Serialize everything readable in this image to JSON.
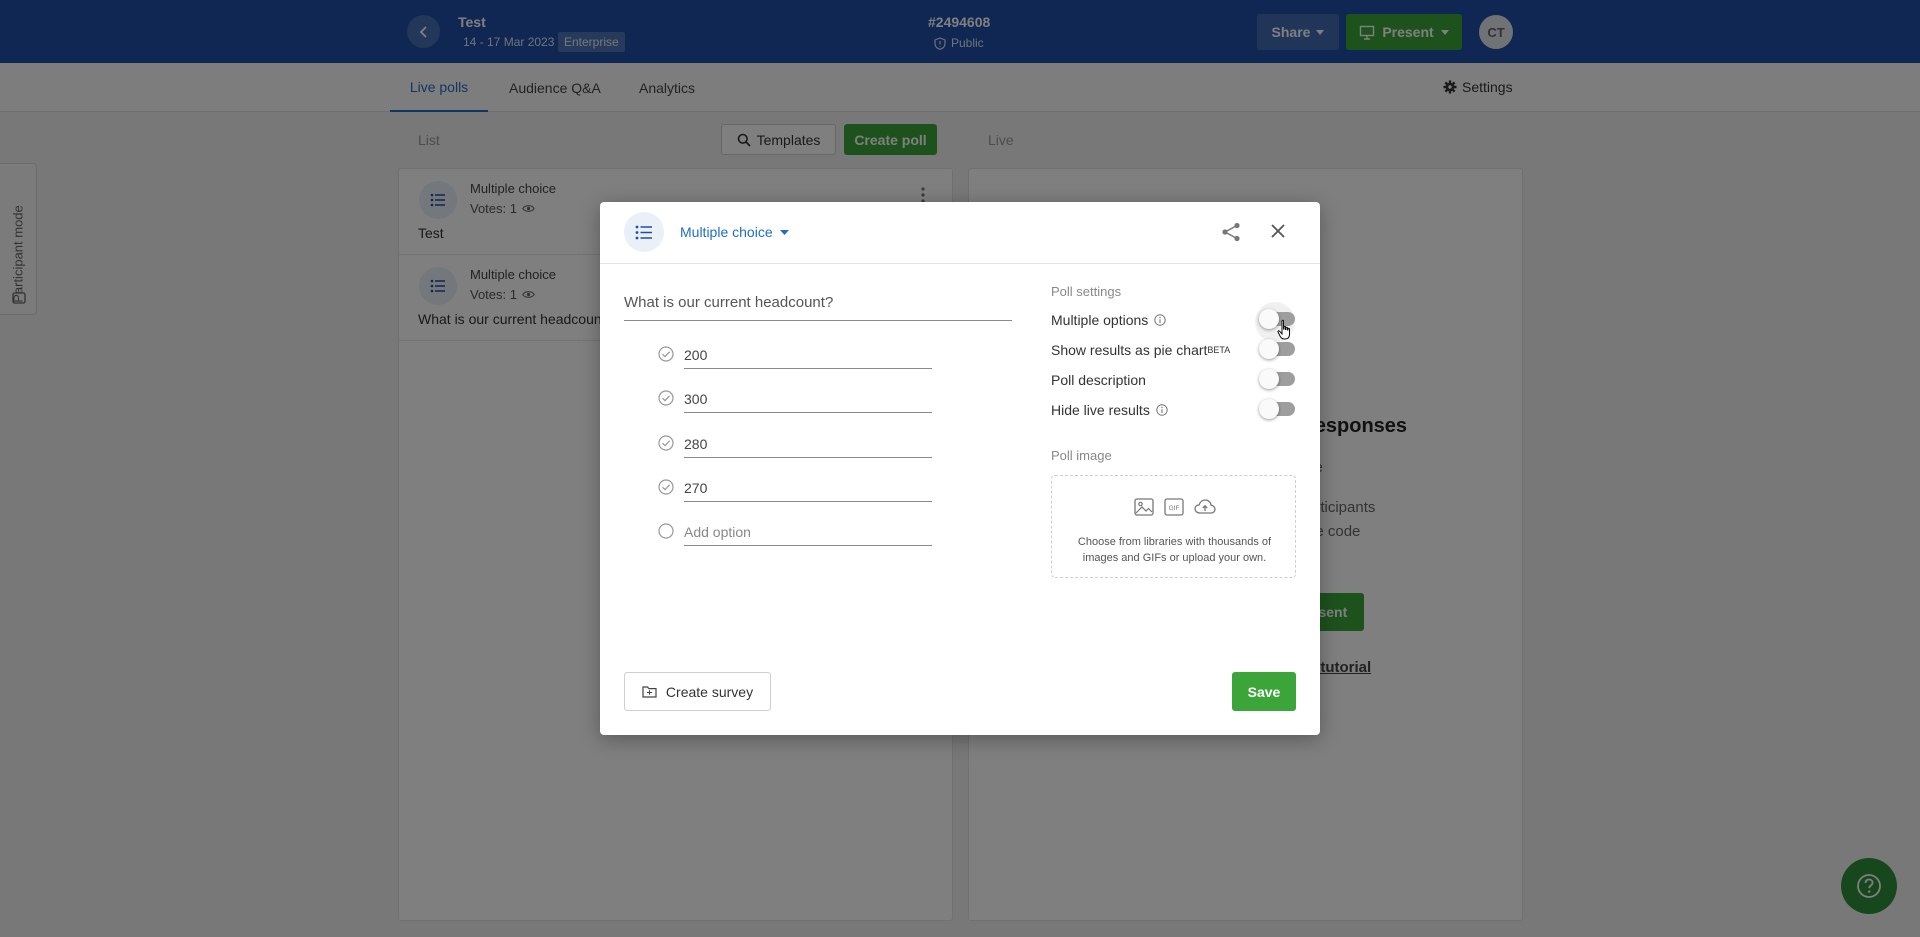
{
  "header": {
    "event_title": "Test",
    "event_dates": "14 - 17 Mar 2023",
    "plan_badge": "Enterprise",
    "event_code": "#2494608",
    "privacy": "Public",
    "share_label": "Share",
    "present_label": "Present",
    "avatar_initials": "CT",
    "accent_color": "#1e4fa4"
  },
  "tabs": {
    "live_polls": "Live polls",
    "audience_qa": "Audience Q&A",
    "analytics": "Analytics",
    "settings": "Settings"
  },
  "side_tab": {
    "label": "Participant mode"
  },
  "list_column": {
    "label": "List",
    "templates_label": "Templates",
    "create_poll_label": "Create poll",
    "polls": [
      {
        "type": "Multiple choice",
        "votes": "Votes: 1",
        "question": "Test"
      },
      {
        "type": "Multiple choice",
        "votes": "Votes: 1",
        "question": "What is our current headcoun"
      }
    ]
  },
  "live_column": {
    "label": "Live",
    "title_fragment": "responses",
    "line1": "ve",
    "line2": "articipants",
    "line3": "he code",
    "present_fragment": "esent",
    "tutorial_fragment": "h tutorial"
  },
  "modal": {
    "poll_type": "Multiple choice",
    "question": "What is our current headcount?",
    "options": [
      "200",
      "300",
      "280",
      "270"
    ],
    "add_option_placeholder": "Add option",
    "settings_title": "Poll settings",
    "settings": {
      "multiple_options": {
        "label": "Multiple options",
        "enabled": false
      },
      "pie_chart": {
        "label": "Show results as pie chart",
        "beta": "BETA",
        "enabled": false
      },
      "description": {
        "label": "Poll description",
        "enabled": false
      },
      "hide_results": {
        "label": "Hide live results",
        "enabled": false
      }
    },
    "image_title": "Poll image",
    "image_help": "Choose from libraries with thousands of images and GIFs or upload your own.",
    "create_survey_label": "Create survey",
    "save_label": "Save"
  },
  "colors": {
    "green": "#3ba53a",
    "blue_link": "#1e6ec8"
  }
}
